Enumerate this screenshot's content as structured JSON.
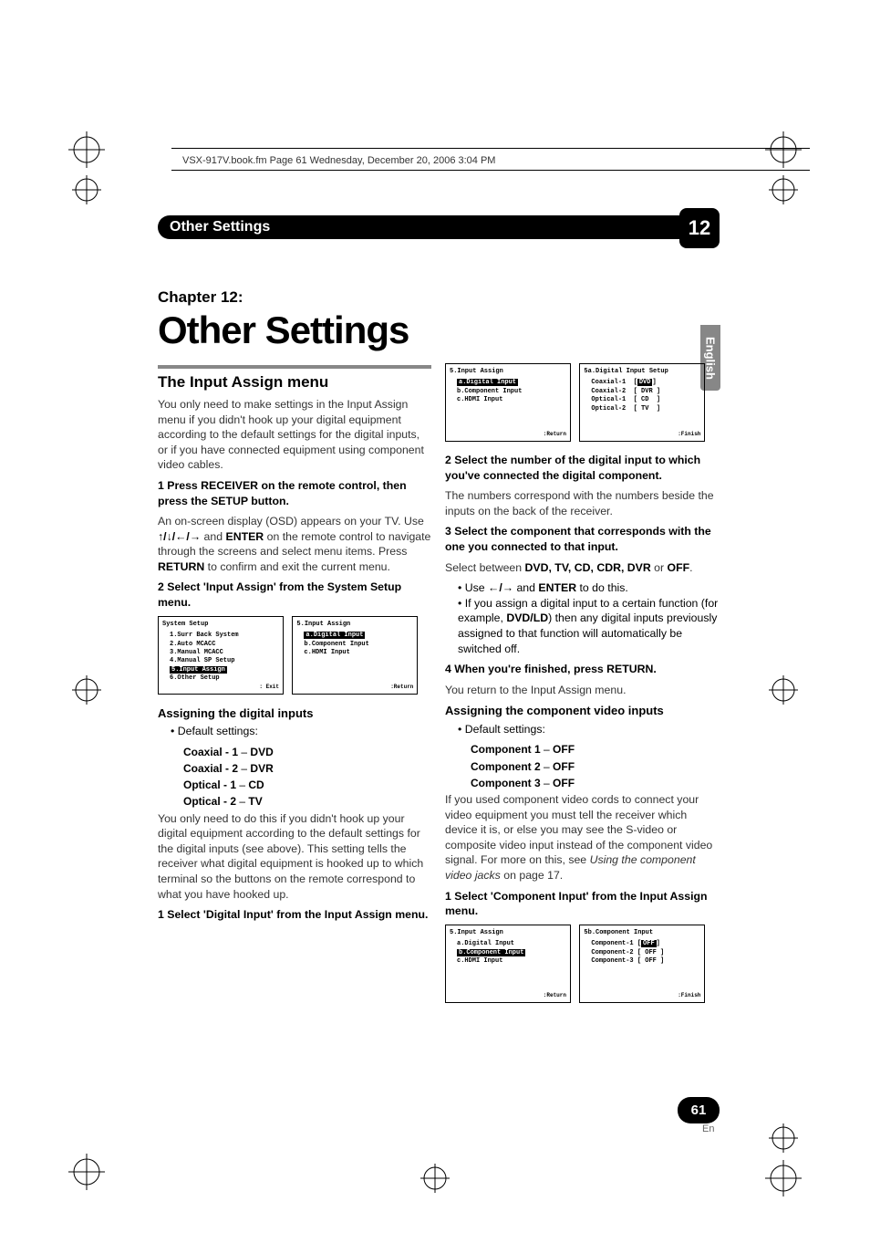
{
  "header": {
    "meta": "VSX-917V.book.fm  Page 61  Wednesday, December 20, 2006  3:04 PM"
  },
  "band": {
    "title": "Other Settings",
    "chapter_num": "12"
  },
  "chapter": {
    "label": "Chapter 12:",
    "title": "Other Settings"
  },
  "sidebar_lang": "English",
  "left": {
    "h2": "The Input Assign menu",
    "p1": "You only need to make settings in the Input Assign menu if you didn't hook up your digital equipment according to the default settings for the digital inputs, or if you have connected equipment using component video cables.",
    "s1": "1    Press RECEIVER on the remote control, then press the SETUP button.",
    "p2a": "An on-screen display (OSD) appears on your TV. Use ",
    "p2b": " and ",
    "p2c": "ENTER",
    "p2d": " on the remote control to navigate through the screens and select menu items. Press ",
    "p2e": "RETURN",
    "p2f": " to confirm and exit the current menu.",
    "s2": "2    Select 'Input Assign' from the System Setup menu.",
    "osd1": {
      "title": "System Setup",
      "items": [
        "1.Surr Back System",
        "2.Auto MCACC",
        "3.Manual MCACC",
        "4.Manual SP Setup",
        "5.Input Assign",
        "6.Other Setup"
      ],
      "foot": ": Exit"
    },
    "osd2": {
      "title": "5.Input Assign",
      "items": [
        "a.Digital Input",
        "b.Component Input",
        "c.HDMI Input"
      ],
      "foot": ":Return"
    },
    "h3a": "Assigning the digital inputs",
    "bul1": "Default settings:",
    "def": [
      {
        "l": "Coaxial - 1",
        "r": "DVD"
      },
      {
        "l": "Coaxial - 2",
        "r": "DVR"
      },
      {
        "l": "Optical - 1",
        "r": "CD"
      },
      {
        "l": "Optical - 2",
        "r": "TV"
      }
    ],
    "p3": "You only need to do this if you didn't hook up your digital equipment according to the default settings for the digital inputs (see above). This setting tells the receiver what digital equipment is hooked up to which terminal so the buttons on the remote correspond to what you have hooked up.",
    "s3": "1    Select 'Digital Input' from the Input Assign menu."
  },
  "right": {
    "osd3": {
      "title": "5.Input Assign",
      "items": [
        "a.Digital Input",
        "b.Component Input",
        "c.HDMI Input"
      ],
      "foot": ":Return"
    },
    "osd4": {
      "title": "5a.Digital Input Setup",
      "rows": [
        {
          "l": "Coaxial-1",
          "r": "DVD",
          "sel": true
        },
        {
          "l": "Coaxial-2",
          "r": "DVR"
        },
        {
          "l": "Optical-1",
          "r": "CD"
        },
        {
          "l": "Optical-2",
          "r": "TV"
        }
      ],
      "foot": ":Finish"
    },
    "s2": "2    Select the number of the digital input to which you've connected the digital component.",
    "p1": "The numbers correspond with the numbers beside the inputs on the back of the receiver.",
    "s3": "3    Select the component that corresponds with the one you connected to that input.",
    "p2a": "Select between ",
    "p2_list": "DVD, TV, CD, CDR, DVR",
    "p2b": " or ",
    "p2c": "OFF",
    "bul1a": "Use ",
    "bul1b": " and ",
    "bul1c": "ENTER",
    "bul1d": " to do this.",
    "bul2a": "If you assign a digital input to a certain function (for example, ",
    "bul2b": "DVD/LD",
    "bul2c": ") then any digital inputs previously assigned to that function will automatically be switched off.",
    "s4": "4    When you're finished, press RETURN.",
    "p3": "You return to the Input Assign menu.",
    "h3b": "Assigning the component video inputs",
    "bul3": "Default settings:",
    "def2": [
      {
        "l": "Component 1",
        "r": "OFF"
      },
      {
        "l": "Component 2",
        "r": "OFF"
      },
      {
        "l": "Component 3",
        "r": "OFF"
      }
    ],
    "p4a": "If you used component video cords to connect your video equipment you must tell the receiver which device it is, or else you may see the S-video or composite video input instead of the component video signal. For more on this, see ",
    "p4b": "Using the component video jacks",
    "p4c": " on page 17.",
    "s5": "1    Select 'Component Input' from the Input Assign menu.",
    "osd5": {
      "title": "5.Input Assign",
      "items": [
        "a.Digital Input",
        "b.Component Input",
        "c.HDMI Input"
      ],
      "foot": ":Return"
    },
    "osd6": {
      "title": "5b.Component Input",
      "rows": [
        {
          "l": "Component-1",
          "r": "OFF",
          "sel": true
        },
        {
          "l": "Component-2",
          "r": "OFF"
        },
        {
          "l": "Component-3",
          "r": "OFF"
        }
      ],
      "foot": ":Finish"
    }
  },
  "footer": {
    "page": "61",
    "lang": "En"
  }
}
